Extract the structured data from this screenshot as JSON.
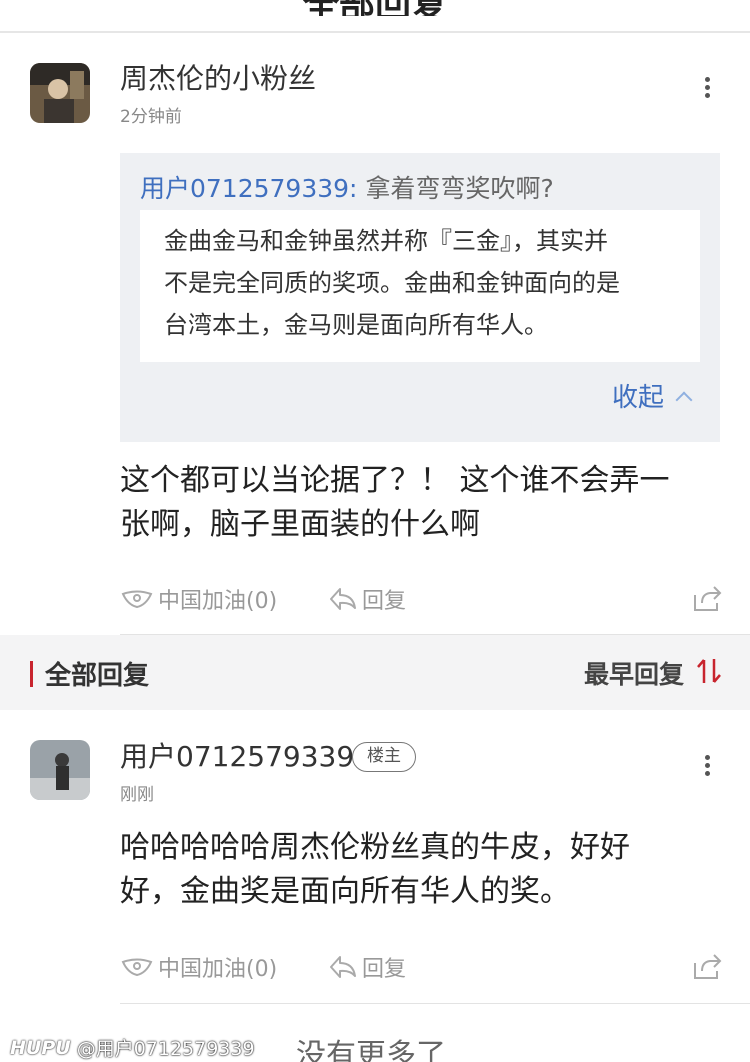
{
  "header": {
    "title": "全部回复"
  },
  "top_comment": {
    "author": "周杰伦的小粉丝",
    "time": "2分钟前",
    "quote": {
      "user": "用户0712579339:",
      "preview": "拿着弯弯奖吹啊?",
      "image_lines": [
        "金曲金马和金钟虽然并称『三金』，其实并",
        "不是完全同质的奖项。金曲和金钟面向的是",
        "台湾本土，金马则是面向所有华人。"
      ],
      "collapse_label": "收起"
    },
    "body_lines": [
      "这个都可以当论据了？！ 这个谁不会弄一",
      "张啊，脑子里面装的什么啊"
    ],
    "cheer_label": "中国加油(0)",
    "reply_label": "回复"
  },
  "section": {
    "title": "全部回复",
    "sort_label": "最早回复"
  },
  "reply_comment": {
    "author": "用户0712579339",
    "badge": "楼主",
    "time": "刚刚",
    "body_lines": [
      "哈哈哈哈哈周杰伦粉丝真的牛皮，好好",
      "好，金曲奖是面向所有华人的奖。"
    ],
    "cheer_label": "中国加油(0)",
    "reply_label": "回复"
  },
  "footer": {
    "no_more": "没有更多了",
    "watermark_logo": "HUPU",
    "watermark_user": "@用户0712579339"
  },
  "colors": {
    "link_blue": "#3f6fbf",
    "accent_red": "#c8242e"
  },
  "icons": [
    "more-vertical-icon",
    "cheer-icon",
    "reply-arrow-icon",
    "share-icon",
    "chevron-up-icon",
    "sort-icon"
  ]
}
